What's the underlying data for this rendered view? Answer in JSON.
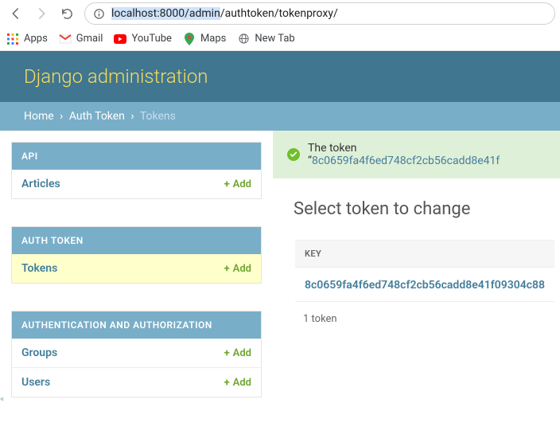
{
  "browser": {
    "url_host_sel": "localhost:8000/admin",
    "url_rest": "/authtoken/tokenproxy/",
    "bookmarks": {
      "apps": "Apps",
      "gmail": "Gmail",
      "youtube": "YouTube",
      "maps": "Maps",
      "newtab": "New Tab"
    }
  },
  "header": {
    "title": "Django administration"
  },
  "breadcrumbs": {
    "home": "Home",
    "app": "Auth Token",
    "current": "Tokens"
  },
  "sidebar": {
    "api": {
      "caption": "API",
      "articles": "Articles",
      "add": "Add"
    },
    "authtoken": {
      "caption": "AUTH TOKEN",
      "tokens": "Tokens",
      "add": "Add"
    },
    "auth": {
      "caption": "AUTHENTICATION AND AUTHORIZATION",
      "groups": "Groups",
      "users": "Users",
      "add": "Add"
    }
  },
  "message": {
    "prefix": "The token “",
    "token": "8c0659fa4f6ed748cf2cb56cadd8e41f"
  },
  "content": {
    "title": "Select token to change",
    "col_key": "KEY",
    "row_key": "8c0659fa4f6ed748cf2cb56cadd8e41f09304c88",
    "paginator": "1 token"
  },
  "toggle": "«"
}
